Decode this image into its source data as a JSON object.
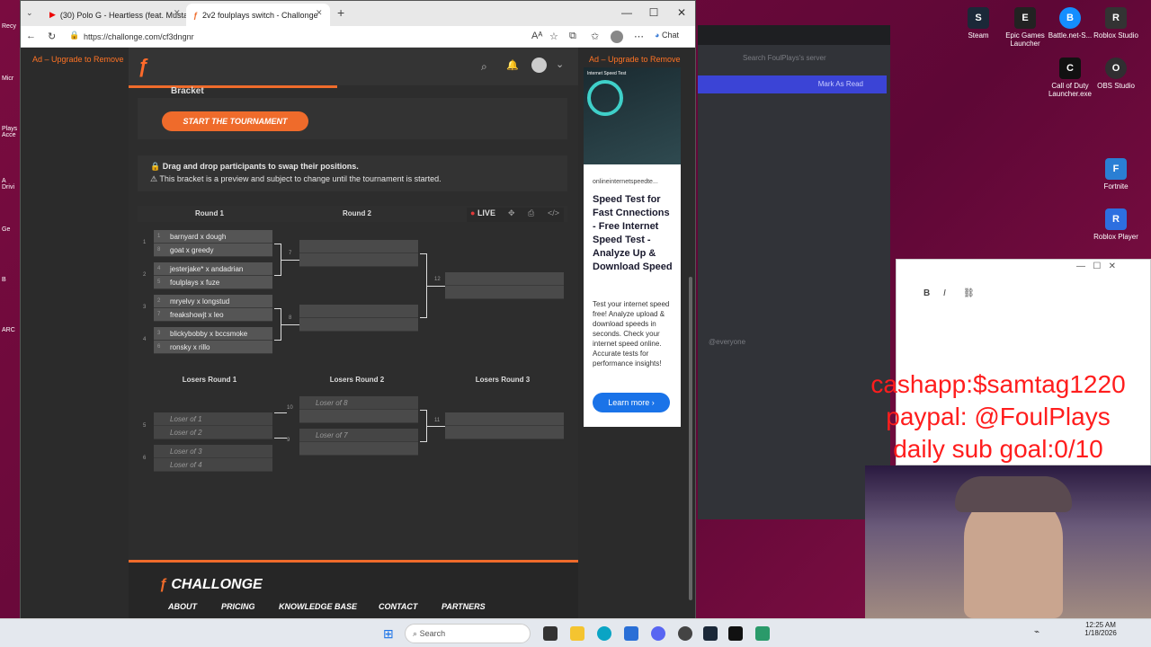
{
  "browser": {
    "tabs": [
      {
        "label": "(30) Polo G - Heartless (feat. Musta..."
      },
      {
        "label": "2v2 foulplays switch - Challonge"
      }
    ],
    "url": "https://challonge.com/cf3dngnr",
    "chat_label": "Chat"
  },
  "ads": {
    "left_label": "Ad – Upgrade to Remove",
    "right_label": "Ad – Upgrade to Remove",
    "panel": {
      "domain": "onlineinternetspeedte...",
      "title": "Speed Test for Fast Cnnections - Free Internet Speed Test - Analyze Up & Download Speed",
      "body": "Test your internet speed free! Analyze upload & download speeds in seconds. Check your internet speed online. Accurate tests for performance insights!",
      "cta": "Learn more",
      "image_caption": "Internet Speed Test"
    }
  },
  "page": {
    "section_title": "Bracket",
    "start_button": "START THE TOURNAMENT",
    "notice_line1": "Drag and drop participants to swap their positions.",
    "notice_line2": "This bracket is a preview and subject to change until the tournament is started.",
    "live_label": "LIVE",
    "winners": {
      "round1": "Round 1",
      "round2": "Round 2",
      "matches": [
        {
          "num": "1",
          "p1": {
            "seed": "1",
            "name": "barnyard x dough"
          },
          "p2": {
            "seed": "8",
            "name": "goat x greedy"
          }
        },
        {
          "num": "2",
          "p1": {
            "seed": "4",
            "name": "jesterjake* x andadrian"
          },
          "p2": {
            "seed": "5",
            "name": "foulplays x fuze"
          }
        },
        {
          "num": "3",
          "p1": {
            "seed": "2",
            "name": "mryelvy x longstud"
          },
          "p2": {
            "seed": "7",
            "name": "freakshowjt x leo"
          }
        },
        {
          "num": "4",
          "p1": {
            "seed": "3",
            "name": "blickybobby x bccsmoke"
          },
          "p2": {
            "seed": "6",
            "name": "ronsky x rillo"
          }
        }
      ],
      "round2_nums": [
        "7",
        "8"
      ],
      "final_num": "12"
    },
    "losers": {
      "round1": "Losers Round 1",
      "round2": "Losers Round 2",
      "round3": "Losers Round 3",
      "r1": [
        {
          "num": "5",
          "p1": "Loser of 1",
          "p2": "Loser of 2"
        },
        {
          "num": "6",
          "p1": "Loser of 3",
          "p2": "Loser of 4"
        }
      ],
      "r2": [
        {
          "num": "10",
          "p1": "Loser of 8"
        },
        {
          "num": "9",
          "p1": "Loser of 7"
        }
      ],
      "r3_num": "11"
    },
    "footer": {
      "brand": "CHALLONGE",
      "links": [
        "ABOUT",
        "PRICING",
        "KNOWLEDGE BASE",
        "CONTACT",
        "PARTNERS"
      ]
    }
  },
  "desktop": {
    "icons_right": [
      {
        "label": "Steam"
      },
      {
        "label": "Epic Games Launcher"
      },
      {
        "label": "Battle.net-S..."
      },
      {
        "label": "Roblox Studio"
      },
      {
        "label": "Call of Duty Launcher.exe"
      },
      {
        "label": "OBS Studio"
      },
      {
        "label": "Fortnite"
      },
      {
        "label": "Roblox Player"
      }
    ],
    "icons_left": [
      "Recy",
      "Micr",
      "Plays Acce",
      "A Drivi",
      "Ge",
      "B",
      "ARC"
    ]
  },
  "discord": {
    "search_placeholder": "Search FoulPlays's server",
    "mark_as_read": "Mark As Read",
    "mention": "@everyone"
  },
  "overlay": {
    "line1": "cashapp:$samtag1220",
    "line2": "paypal: @FoulPlays",
    "line3": "daily sub goal:0/10"
  },
  "taskbar": {
    "search_placeholder": "Search",
    "time": "12:25 AM",
    "date": "1/18/2026"
  },
  "colors": {
    "accent": "#ef6b2b",
    "live": "#e23a3a"
  }
}
